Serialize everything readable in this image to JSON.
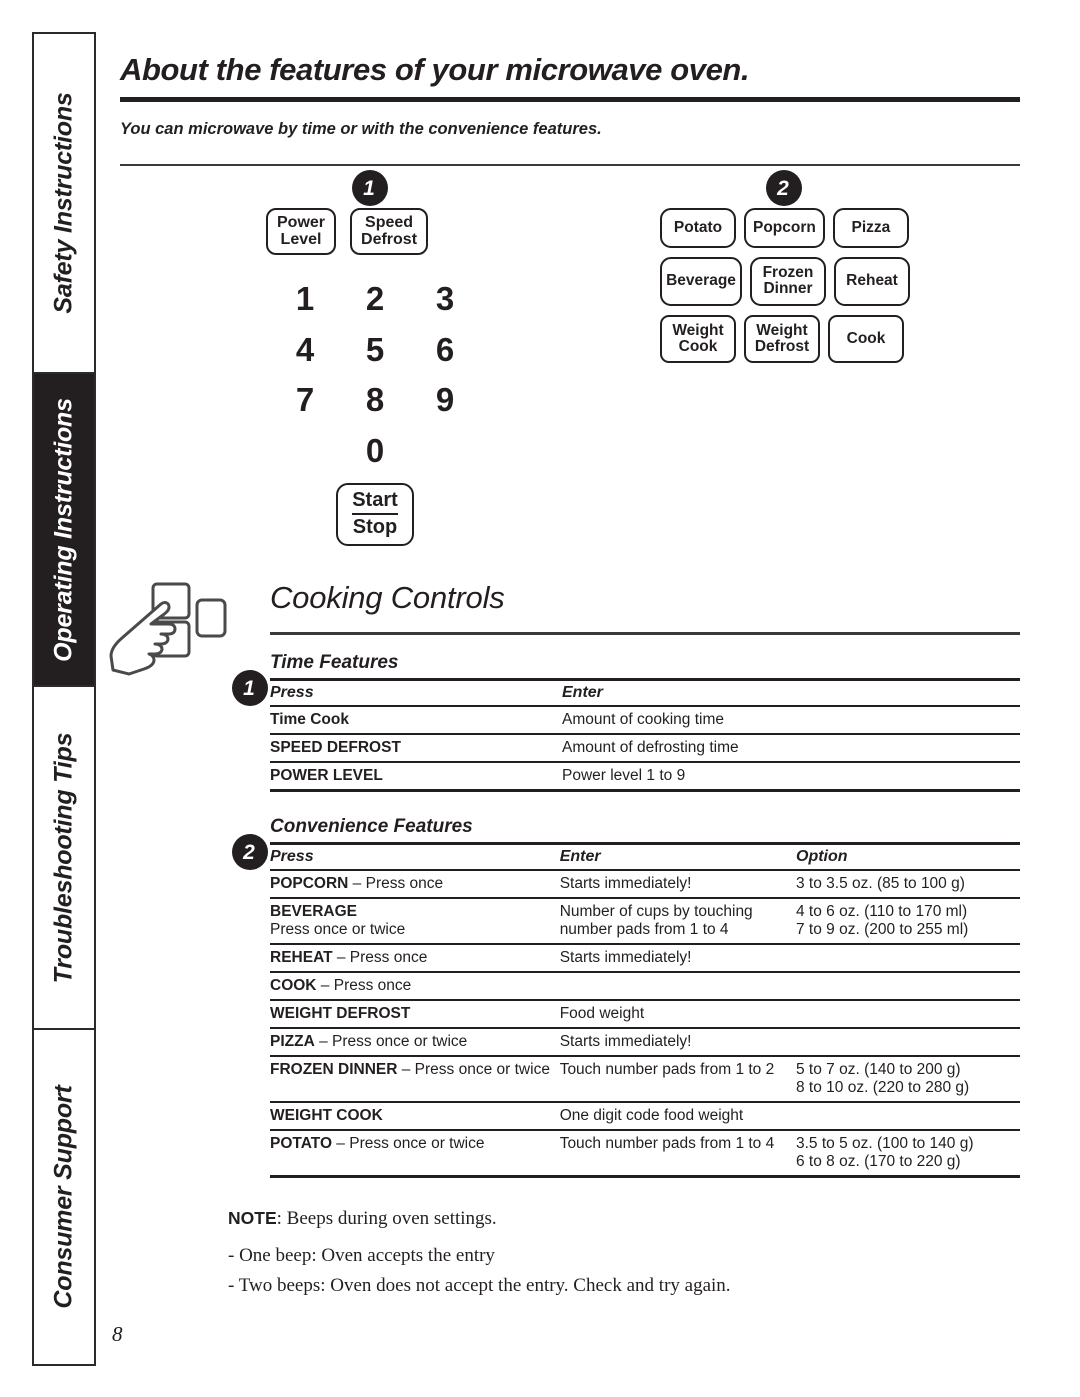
{
  "sidebar": {
    "tabs": [
      {
        "label": "Safety Instructions",
        "active": false
      },
      {
        "label": "Operating Instructions",
        "active": true
      },
      {
        "label": "Troubleshooting Tips",
        "active": false
      },
      {
        "label": "Consumer Support",
        "active": false
      }
    ]
  },
  "header": {
    "title": "About the features of your microwave oven.",
    "subtitle": "You can microwave by time or with the convenience features."
  },
  "diagram": {
    "time_badge": "1",
    "convenience_badge": "2",
    "keypad": {
      "top_buttons": [
        "Power\nLevel",
        "Speed\nDefrost"
      ],
      "numbers": [
        "1",
        "2",
        "3",
        "4",
        "5",
        "6",
        "7",
        "8",
        "9",
        "0"
      ],
      "start_label": "Start",
      "stop_label": "Stop"
    },
    "convenience_buttons": [
      [
        "Potato",
        "Popcorn",
        "Pizza"
      ],
      [
        "Beverage",
        "Frozen\nDinner",
        "Reheat"
      ],
      [
        "Weight\nCook",
        "Weight\nDefrost",
        "Cook"
      ]
    ]
  },
  "cooking_controls": {
    "title": "Cooking Controls",
    "time_features": {
      "badge": "1",
      "title": "Time Features",
      "headers": [
        "Press",
        "Enter"
      ],
      "rows": [
        {
          "press": "Time Cook",
          "enter": "Amount of cooking time"
        },
        {
          "press": "SPEED DEFROST",
          "enter": "Amount of defrosting time"
        },
        {
          "press": "POWER LEVEL",
          "enter": "Power level 1 to 9"
        }
      ]
    },
    "convenience_features": {
      "badge": "2",
      "title": "Convenience Features",
      "headers": [
        "Press",
        "Enter",
        "Option"
      ],
      "rows": [
        {
          "press_bold": "POPCORN",
          "press_rest": " – Press once",
          "press_sub": "",
          "enter": "Starts immediately!",
          "enter_sub": "",
          "option": "3 to 3.5 oz. (85 to 100 g)",
          "option2": ""
        },
        {
          "press_bold": "BEVERAGE",
          "press_rest": "",
          "press_sub": "Press once or twice",
          "enter": "Number of cups by touching",
          "enter_sub": "number pads from 1 to 4",
          "option": "4 to 6 oz. (110 to 170 ml)",
          "option2": "7 to 9 oz. (200 to 255 ml)"
        },
        {
          "press_bold": "REHEAT",
          "press_rest": " – Press once",
          "press_sub": "",
          "enter": "Starts immediately!",
          "enter_sub": "",
          "option": "",
          "option2": ""
        },
        {
          "press_bold": "COOK",
          "press_rest": " – Press once",
          "press_sub": "",
          "enter": "",
          "enter_sub": "",
          "option": "",
          "option2": ""
        },
        {
          "press_bold": "WEIGHT DEFROST",
          "press_rest": "",
          "press_sub": "",
          "enter": "Food weight",
          "enter_sub": "",
          "option": "",
          "option2": ""
        },
        {
          "press_bold": "PIZZA",
          "press_rest": " – Press once or twice",
          "press_sub": "",
          "enter": "Starts immediately!",
          "enter_sub": "",
          "option": "",
          "option2": ""
        },
        {
          "press_bold": "FROZEN DINNER",
          "press_rest": " – Press once or twice",
          "press_sub": "",
          "enter": "Touch number pads from 1 to 2",
          "enter_sub": "",
          "option": "5 to 7 oz. (140 to 200 g)",
          "option2": "8 to 10 oz. (220 to 280 g)"
        },
        {
          "press_bold": "WEIGHT COOK",
          "press_rest": "",
          "press_sub": "",
          "enter": "One digit code food weight",
          "enter_sub": "",
          "option": "",
          "option2": ""
        },
        {
          "press_bold": "POTATO",
          "press_rest": " – Press once or twice",
          "press_sub": "",
          "enter": "Touch number pads from 1 to 4",
          "enter_sub": "",
          "option": "3.5 to 5 oz. (100 to 140 g)",
          "option2": "6 to 8 oz. (170 to 220 g)"
        }
      ]
    }
  },
  "note": {
    "label": "NOTE",
    "title_rest": ": Beeps during oven settings.",
    "lines": [
      "- One beep: Oven accepts the entry",
      "- Two beeps: Oven does not accept the entry. Check and try again."
    ]
  },
  "footer": {
    "page_number": "8"
  },
  "colors": {
    "ink": "#231f20",
    "tab_active_bg": "#231f20",
    "paper": "#ffffff"
  }
}
